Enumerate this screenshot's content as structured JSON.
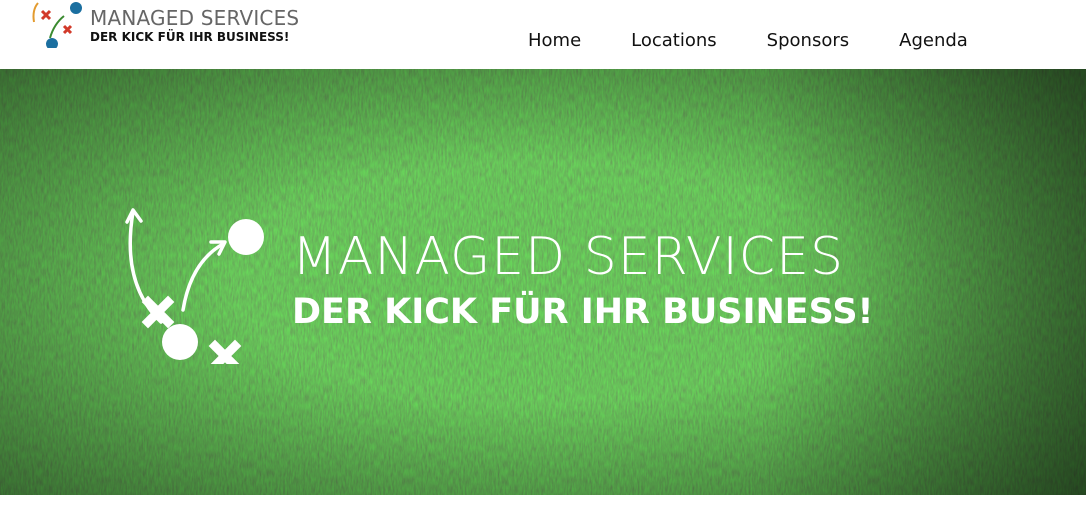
{
  "header": {
    "logo": {
      "title": "MANAGED SERVICES",
      "subtitle": "DER KICK FÜR IHR BUSINESS!",
      "icon": "tactics-board-icon",
      "colors": {
        "ball": "#1b6fa0",
        "x_mark": "#d23a2a",
        "arrow_left": "#e39b2f",
        "arrow_right": "#3a8a2f"
      }
    },
    "nav": [
      {
        "label": "Home"
      },
      {
        "label": "Locations"
      },
      {
        "label": "Sponsors"
      },
      {
        "label": "Agenda"
      }
    ]
  },
  "hero": {
    "background": "grass-texture",
    "icon": "tactics-board-icon",
    "title": "MANAGED SERVICES",
    "subtitle": "DER KICK FÜR IHR BUSINESS!"
  }
}
